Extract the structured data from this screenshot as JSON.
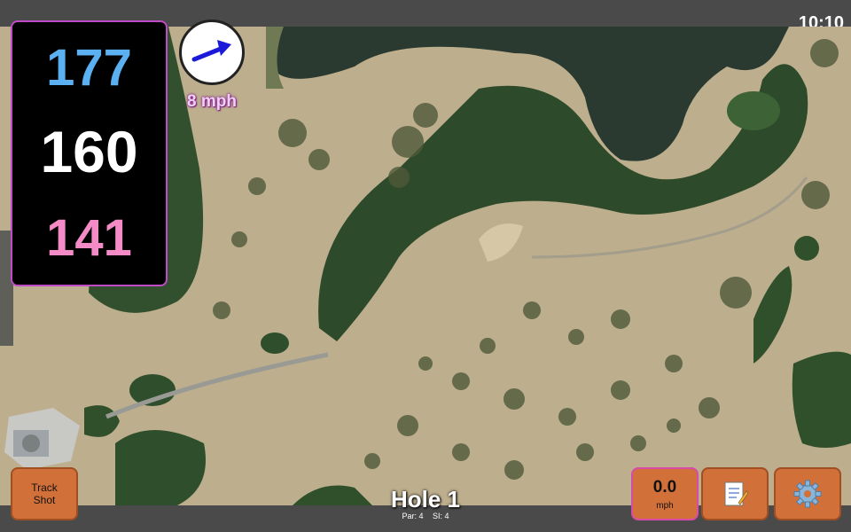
{
  "status": {
    "time": "10:10"
  },
  "yardages": {
    "back": "177",
    "middle": "160",
    "front": "141"
  },
  "wind": {
    "speed": "8 mph",
    "icon": "arrow-icon"
  },
  "buttons": {
    "track_shot": "Track Shot",
    "speed_value": "0.0",
    "speed_unit": "mph",
    "notes_icon": "notepad-icon",
    "settings_icon": "gear-icon"
  },
  "hole": {
    "title": "Hole 1",
    "par": "Par: 4",
    "si": "SI: 4"
  },
  "colors": {
    "back": "#5ab0f0",
    "middle": "#ffffff",
    "front": "#f48bc7",
    "button": "#d2703a"
  }
}
